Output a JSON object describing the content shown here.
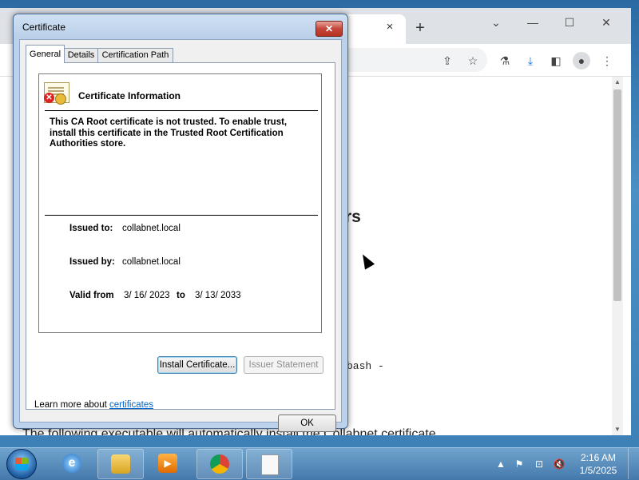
{
  "browser": {
    "tab_close_icon": "×",
    "new_tab_icon": "+",
    "window_controls": {
      "dropdown": "⌄",
      "minimize": "—",
      "maximize": "☐",
      "close": "✕"
    },
    "toolbar_icons": [
      "share-icon",
      "star-icon",
      "labs-icon",
      "download-icon",
      "sidebar-icon",
      "profile-icon",
      "menu-icon"
    ],
    "page": {
      "heading_fragment": "rs",
      "code_fragment": "bash -",
      "paragraph_fragment": "The following executable will automatically install the Collabnet certificate"
    }
  },
  "dialog": {
    "title": "Certificate",
    "close_icon": "✕",
    "tabs": [
      {
        "label": "General",
        "active": true
      },
      {
        "label": "Details",
        "active": false
      },
      {
        "label": "Certification Path",
        "active": false
      }
    ],
    "info_title": "Certificate Information",
    "warning_text": "This CA Root certificate is not trusted. To enable trust, install this certificate in the Trusted Root Certification Authorities store.",
    "issued_to_label": "Issued to:",
    "issued_to_value": "collabnet.local",
    "issued_by_label": "Issued by:",
    "issued_by_value": "collabnet.local",
    "valid_from_label": "Valid from",
    "valid_from_value": "3/ 16/ 2023",
    "valid_to_label": "to",
    "valid_to_value": "3/ 13/ 2033",
    "install_button": "Install Certificate...",
    "issuer_statement_button": "Issuer Statement",
    "learn_more_prefix": "Learn more about",
    "learn_more_link": "certificates",
    "ok_button": "OK"
  },
  "taskbar": {
    "items": [
      "start-button",
      "internet-explorer",
      "file-explorer",
      "media-player",
      "chrome",
      "blank-document"
    ],
    "tray": {
      "chevron": "▲",
      "flag": "⚑",
      "network": "⊡",
      "volume": "🔇"
    },
    "time": "2:16 AM",
    "date": "1/5/2025"
  },
  "colors": {
    "titlebar": "#c3d7ee",
    "close_button": "#c4473a",
    "link": "#0066cc",
    "taskbar": "#4a7aa8"
  }
}
